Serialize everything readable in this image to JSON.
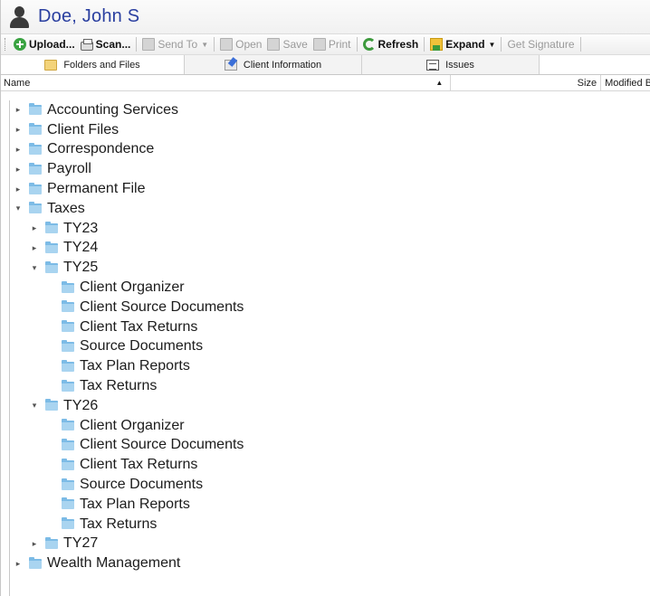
{
  "window": {
    "title": "Doe, John S"
  },
  "toolbar": {
    "upload": "Upload...",
    "scan": "Scan...",
    "send_to": "Send To",
    "open": "Open",
    "save": "Save",
    "print": "Print",
    "refresh": "Refresh",
    "expand": "Expand",
    "get_signature": "Get Signature"
  },
  "tabs": [
    {
      "label": "Folders and Files",
      "icon": "folder-icon",
      "active": true
    },
    {
      "label": "Client Information",
      "icon": "client-info-icon",
      "active": false
    },
    {
      "label": "Issues",
      "icon": "issues-icon",
      "active": false
    }
  ],
  "grid": {
    "columns": {
      "name": "Name",
      "size": "Size",
      "modified": "Modified B"
    },
    "sort": "ascending"
  },
  "tree": {
    "accounting": "Accounting Services",
    "client_files": "Client Files",
    "correspondence": "Correspondence",
    "payroll": "Payroll",
    "permanent": "Permanent File",
    "taxes": "Taxes",
    "ty23": "TY23",
    "ty24": "TY24",
    "ty25": "TY25",
    "ty25_children": [
      "Client Organizer",
      "Client Source Documents",
      "Client Tax Returns",
      "Source Documents",
      "Tax Plan Reports",
      "Tax Returns"
    ],
    "ty26": "TY26",
    "ty26_children": [
      "Client Organizer",
      "Client Source Documents",
      "Client Tax Returns",
      "Source Documents",
      "Tax Plan Reports",
      "Tax Returns"
    ],
    "ty27": "TY27",
    "wealth": "Wealth Management"
  }
}
